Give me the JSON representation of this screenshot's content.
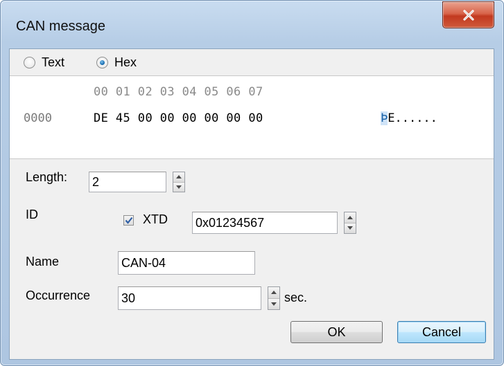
{
  "window": {
    "title": "CAN message",
    "close_label": "x"
  },
  "mode": {
    "options": [
      {
        "label": "Text",
        "checked": false
      },
      {
        "label": "Hex",
        "checked": true
      }
    ]
  },
  "hex": {
    "header": "00 01 02 03 04 05 06 07",
    "rows": [
      {
        "offset": "0000",
        "bytes": "DE 45 00 00 00 00 00 00",
        "ascii_selected": "Þ",
        "ascii_rest": "E......"
      }
    ]
  },
  "form": {
    "length_label": "Length:",
    "length_value": "2",
    "id_label": "ID",
    "xtd_label": "XTD",
    "xtd_checked": true,
    "id_value": "0x01234567",
    "name_label": "Name",
    "name_value": "CAN-04",
    "occurrence_label": "Occurrence",
    "occurrence_value": "30",
    "occurrence_unit": "sec."
  },
  "buttons": {
    "ok": "OK",
    "cancel": "Cancel"
  },
  "colors": {
    "accent": "#1b6fb2",
    "close": "#c2391f"
  }
}
